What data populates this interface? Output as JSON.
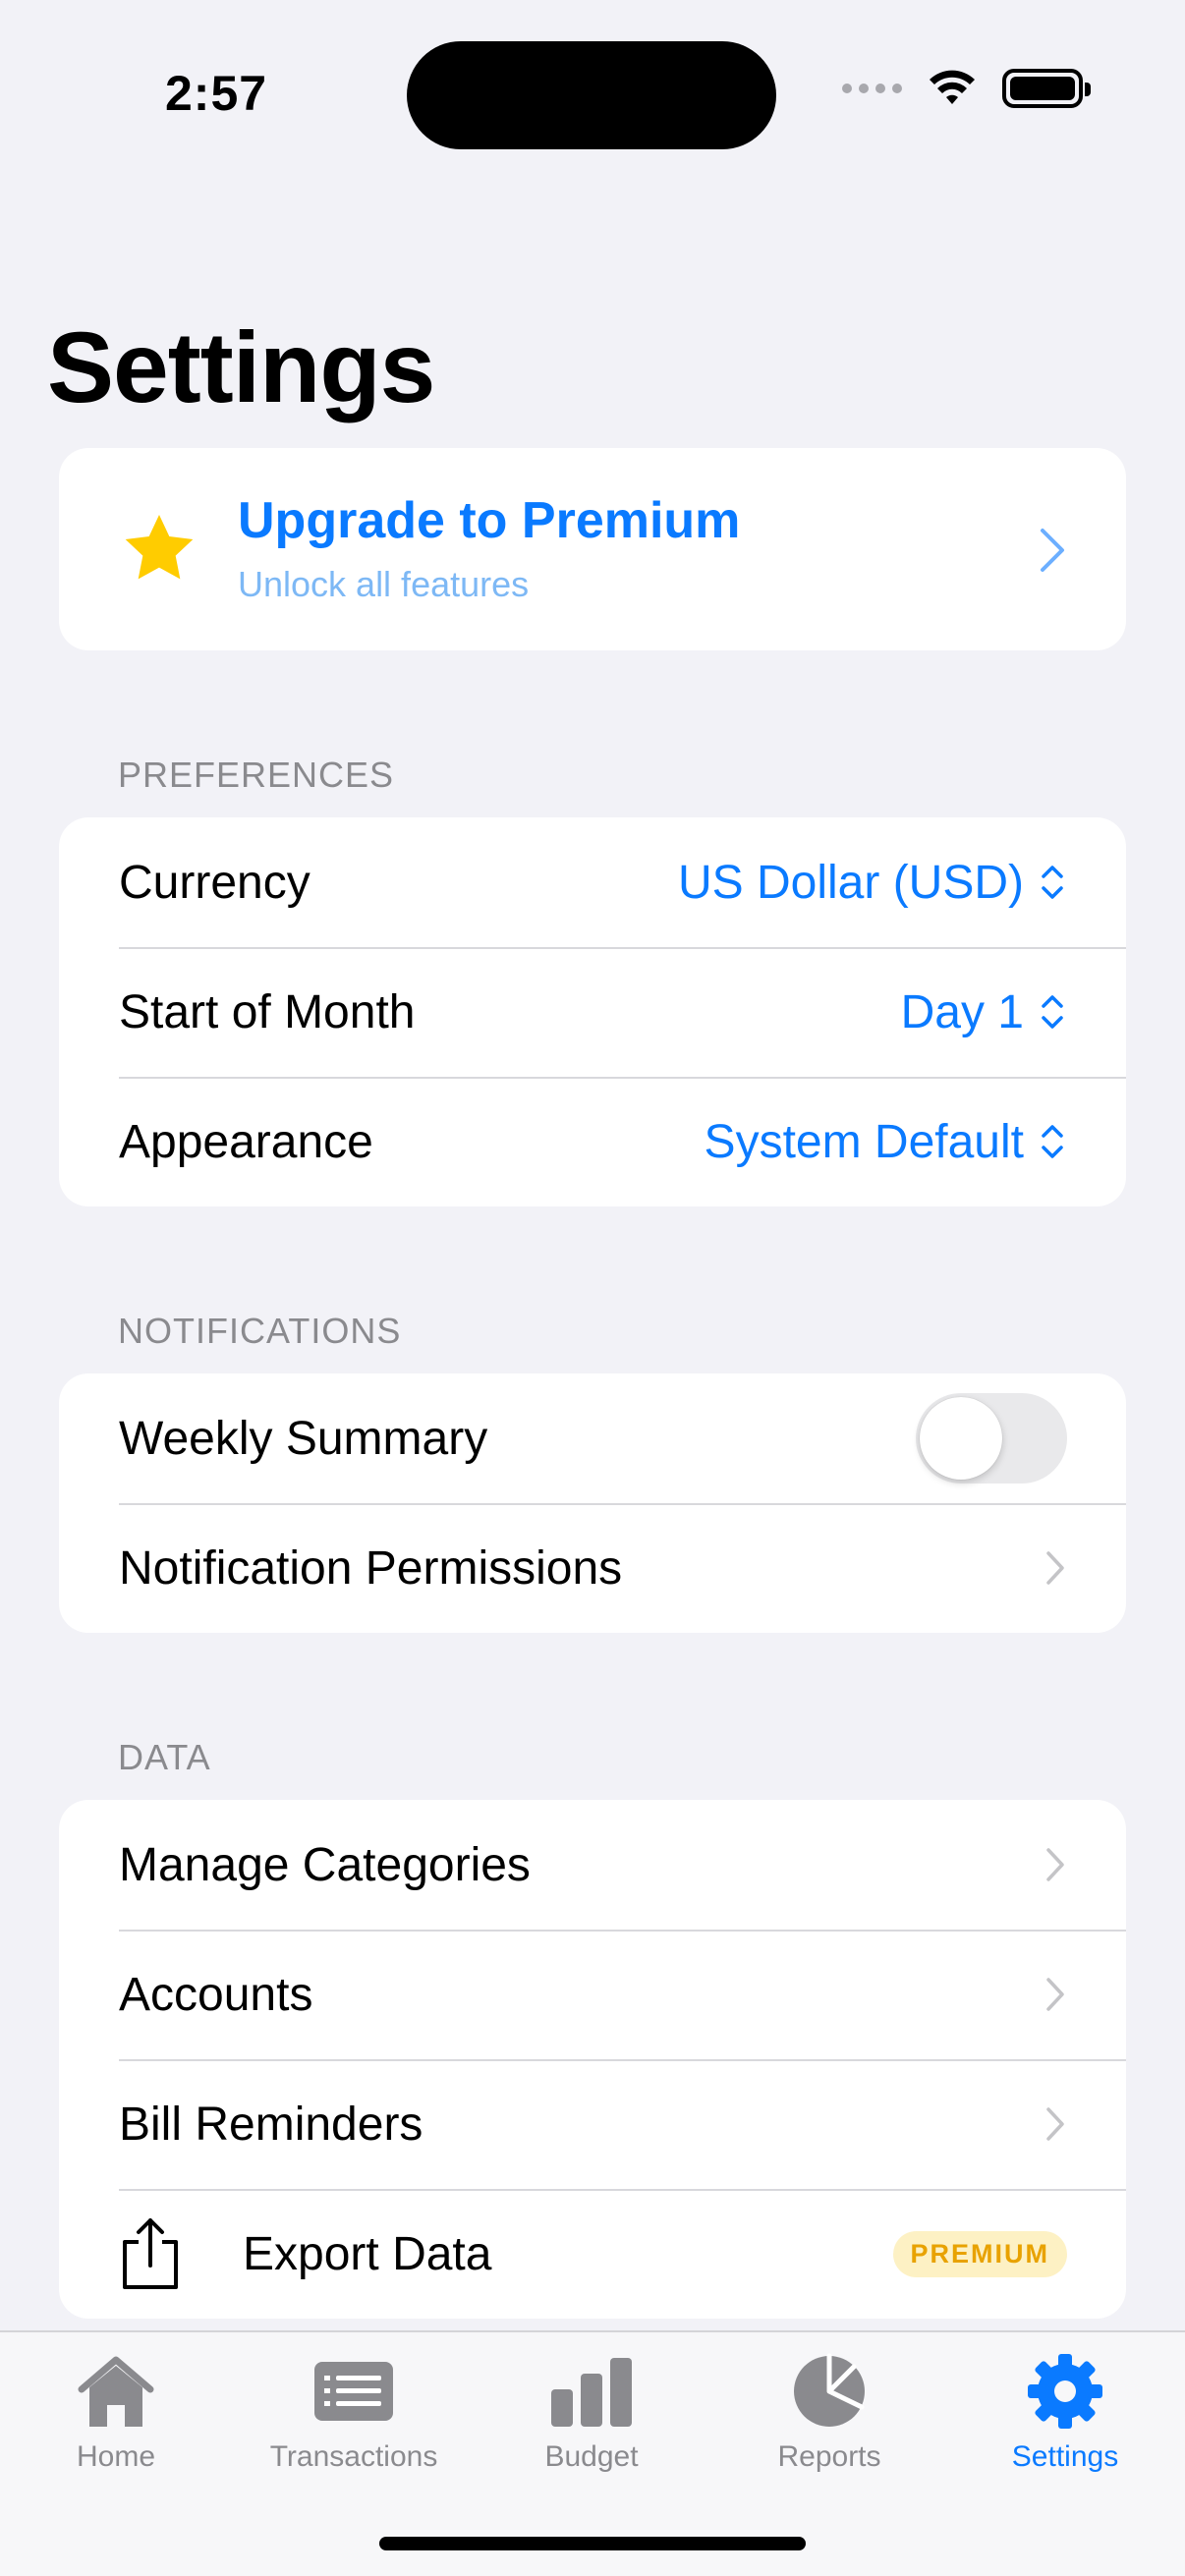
{
  "status_bar": {
    "time": "2:57"
  },
  "page_title": "Settings",
  "premium": {
    "title": "Upgrade to Premium",
    "subtitle": "Unlock all features"
  },
  "preferences": {
    "header": "PREFERENCES",
    "rows": [
      {
        "label": "Currency",
        "value": "US Dollar (USD)"
      },
      {
        "label": "Start of Month",
        "value": "Day 1"
      },
      {
        "label": "Appearance",
        "value": "System Default"
      }
    ]
  },
  "notifications": {
    "header": "NOTIFICATIONS",
    "weekly_summary": {
      "label": "Weekly Summary",
      "enabled": false
    },
    "permissions": {
      "label": "Notification Permissions"
    }
  },
  "data": {
    "header": "DATA",
    "rows": [
      {
        "label": "Manage Categories"
      },
      {
        "label": "Accounts"
      },
      {
        "label": "Bill Reminders"
      }
    ],
    "export": {
      "label": "Export Data",
      "badge": "PREMIUM"
    }
  },
  "tabs": [
    {
      "label": "Home",
      "icon": "house-icon"
    },
    {
      "label": "Transactions",
      "icon": "list-icon"
    },
    {
      "label": "Budget",
      "icon": "bar-chart-icon"
    },
    {
      "label": "Reports",
      "icon": "pie-chart-icon"
    },
    {
      "label": "Settings",
      "icon": "gear-icon",
      "active": true
    }
  ],
  "colors": {
    "accent": "#0A7AFF",
    "star": "#FFCC00",
    "badge_bg": "#FDF1C4",
    "badge_text": "#E8A200",
    "background": "#F2F2F7"
  }
}
